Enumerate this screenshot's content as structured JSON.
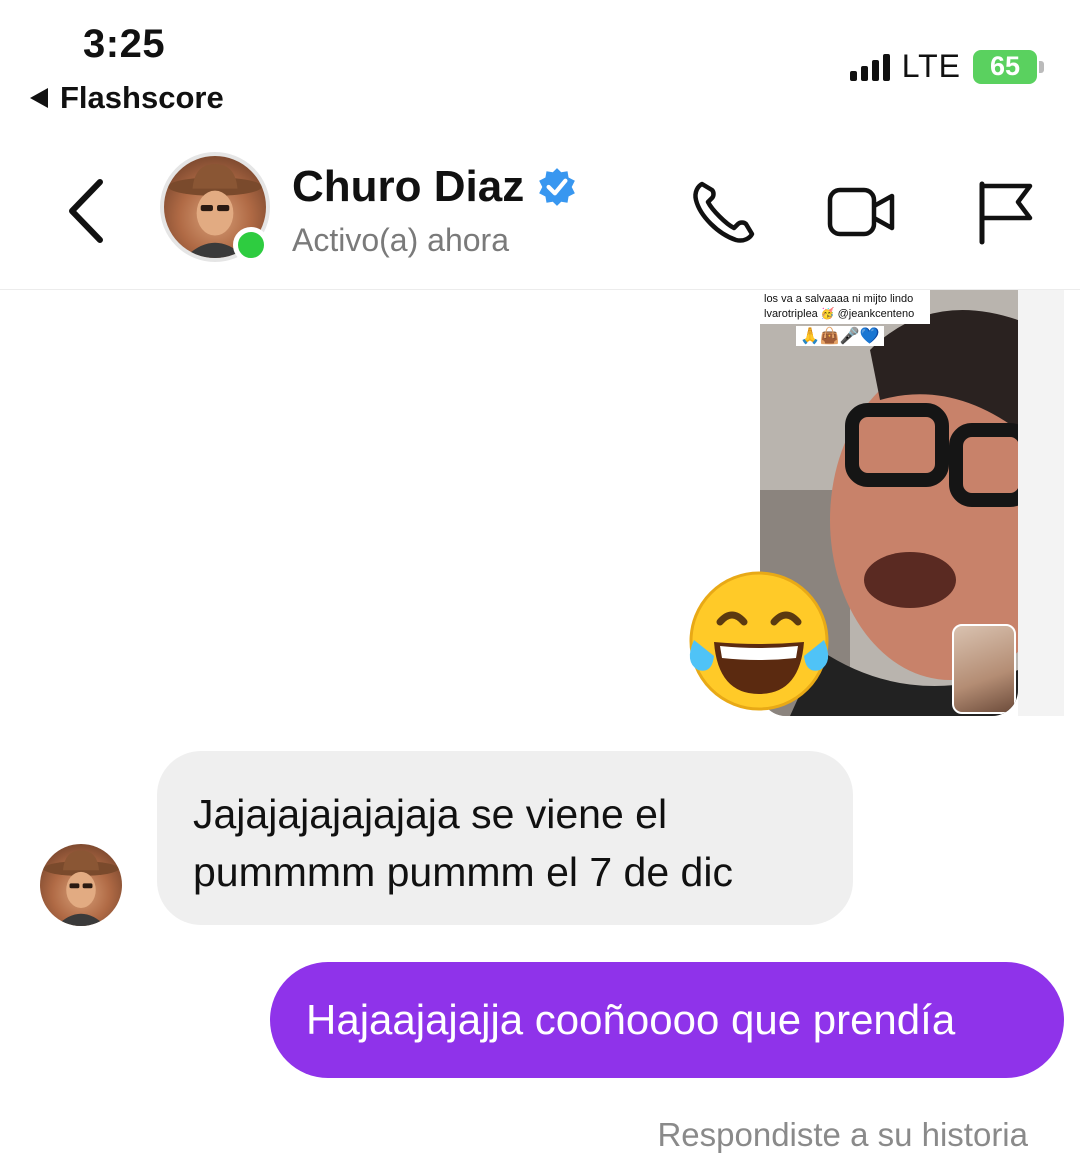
{
  "status_bar": {
    "time": "3:25",
    "back_app": "Flashscore",
    "network": "LTE",
    "battery": "65"
  },
  "header": {
    "contact_name": "Churo Diaz",
    "activity": "Activo(a) ahora"
  },
  "story": {
    "caption_line1": "los va a salvaaaa ni mijto lindo",
    "caption_line2": "lvarotriplea 🥳 @jeankcenteno",
    "caption_emojis": "🙏👜🎤💙",
    "reaction_emoji": "😂"
  },
  "messages": [
    {
      "direction": "incoming",
      "text": "Jajajajajajajaja se viene el pummmm pummm el 7 de dic"
    },
    {
      "direction": "outgoing",
      "text": "Hajaajajajja cooñoooo que prendía"
    }
  ],
  "reply_note": "Respondiste a su historia",
  "colors": {
    "outgoing_bubble": "#8f33ea",
    "incoming_bubble": "#efefef",
    "online": "#2ecc40",
    "verified": "#3897f0",
    "battery": "#5ad15f"
  }
}
